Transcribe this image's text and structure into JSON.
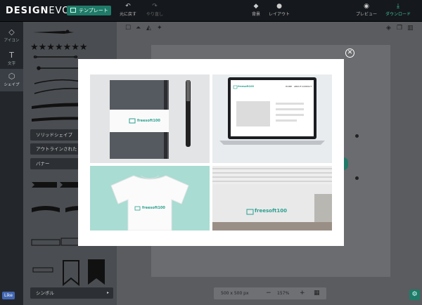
{
  "app": {
    "logo_main": "DESIGN",
    "logo_sub": "EVO",
    "template_button": "テンプレート"
  },
  "toolbar": {
    "undo": "元に戻す",
    "redo": "やり直し",
    "background": "背景",
    "layout": "レイアウト",
    "preview": "プレビュー",
    "download": "ダウンロード"
  },
  "leftnav": {
    "icons": "アイコン",
    "text": "文字",
    "shapes": "シェイプ"
  },
  "shapes_panel": {
    "menus": [
      {
        "label": "ソリッドシェイプ"
      },
      {
        "label": "アウトラインされた"
      },
      {
        "label": "バナー"
      },
      {
        "label": "シンボル"
      }
    ]
  },
  "social": {
    "like": "Like"
  },
  "bottom": {
    "size": "500 x 500 px",
    "zoom": "157%",
    "minus": "−",
    "plus": "+"
  },
  "modal": {
    "brand": "freesoft100",
    "laptop_nav": [
      "HOME",
      "ABOUT",
      "CONTACT"
    ]
  },
  "colors": {
    "accent": "#1f7b67",
    "brand_text": "#2a9f8e"
  }
}
